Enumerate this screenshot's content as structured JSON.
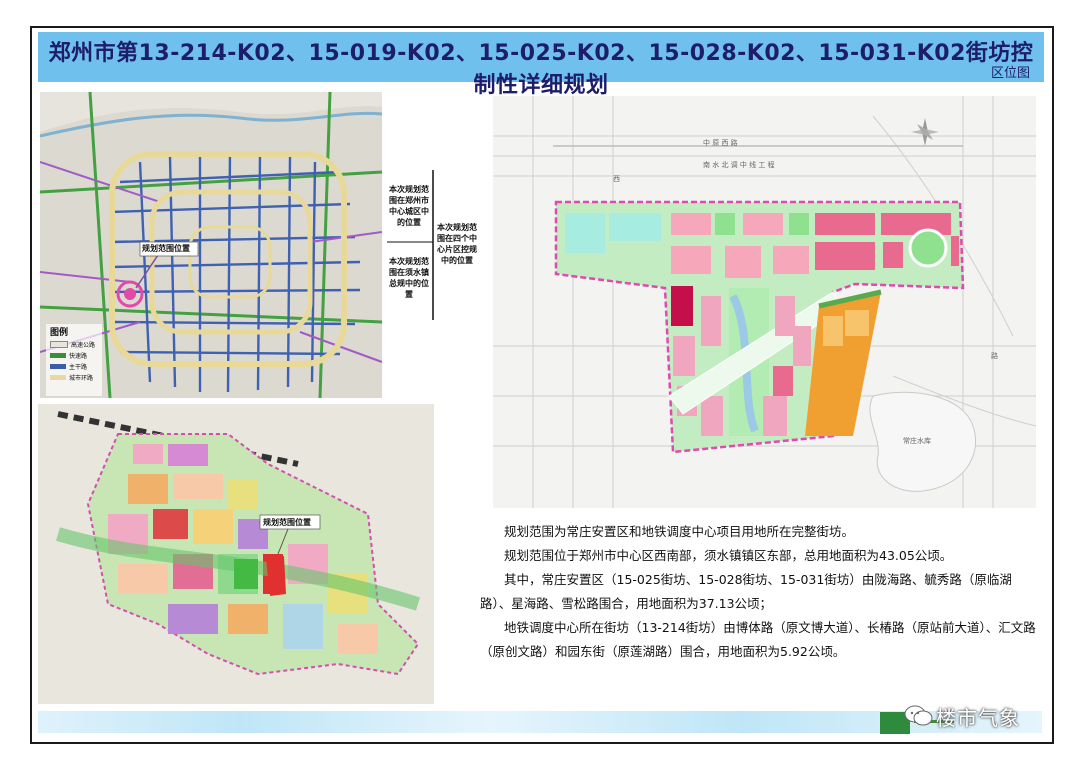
{
  "header": {
    "title": "郑州市第13-214-K02、15-019-K02、15-025-K02、15-028-K02、15-031-K02街坊控制性详细规划",
    "subtitle": "区位图"
  },
  "map_city": {
    "label_plan": "规划范围位置",
    "legend_title": "图例",
    "legend": [
      {
        "label": "高速公路",
        "color": "#e8e4dc"
      },
      {
        "label": "快速路",
        "color": "#3b8f3b"
      },
      {
        "label": "主干路",
        "color": "#3b5ea8"
      },
      {
        "label": "城市环路",
        "color": "#e7d9a3"
      }
    ]
  },
  "map_town": {
    "label_plan": "规划范围位置"
  },
  "callouts": {
    "a": "本次规划范围在郑州市中心城区中的位置",
    "b": "本次规划范围在须水镇总规中的位置",
    "c": "本次规划范围在四个中心片区控规中的位置"
  },
  "map_site": {
    "north_road": "中 原 西 路",
    "sub_road": "南 水 北 调 中 线 工 程",
    "lake": "常庄水库",
    "road_west": "西",
    "road_mid": "路",
    "road_right": "路"
  },
  "description": [
    "规划范围为常庄安置区和地铁调度中心项目用地所在完整街坊。",
    "规划范围位于郑州市中心区西南部，须水镇镇区东部，总用地面积为43.05公顷。",
    "其中，常庄安置区（15-025街坊、15-028街坊、15-031街坊）由陇海路、毓秀路（原临湖路）、星海路、雪松路围合，用地面积为37.13公顷；",
    "地铁调度中心所在街坊（13-214街坊）由博体路（原文博大道）、长椿路（原站前大道）、汇文路（原创文路）和园东街（原莲湖路）围合，用地面积为5.92公顷。"
  ],
  "watermark": "楼市气象",
  "colors": {
    "title_bar": "#6fc0ec",
    "title_text": "#1d1d6b",
    "boundary": "#e04ab0",
    "green": "#9be39b",
    "residential": "#f0a8bd",
    "commercial": "#e26d95",
    "industrial": "#f0a030",
    "education": "#f8b2c3",
    "water": "#cfe6ea"
  }
}
